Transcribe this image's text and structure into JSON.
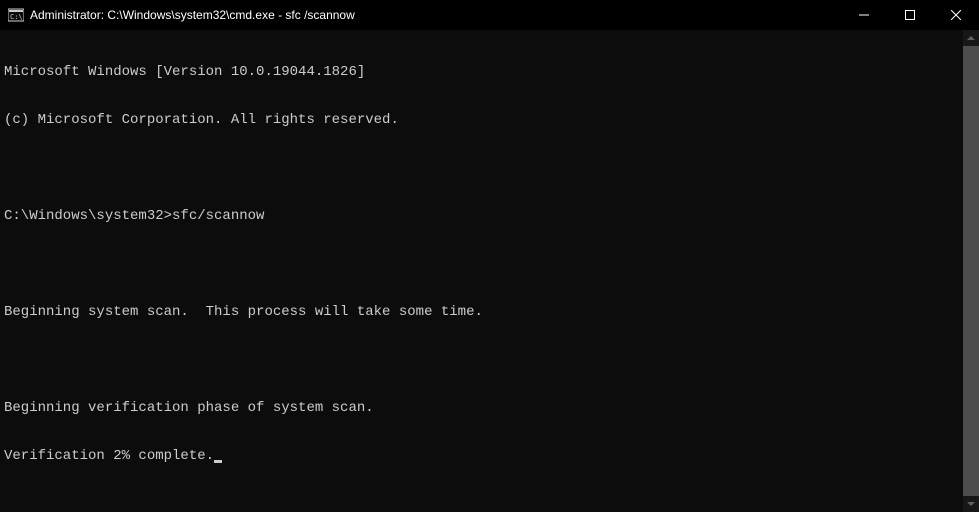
{
  "titlebar": {
    "title": "Administrator: C:\\Windows\\system32\\cmd.exe - sfc /scannow"
  },
  "terminal": {
    "lines": [
      "Microsoft Windows [Version 10.0.19044.1826]",
      "(c) Microsoft Corporation. All rights reserved.",
      "",
      "C:\\Windows\\system32>sfc/scannow",
      "",
      "Beginning system scan.  This process will take some time.",
      "",
      "Beginning verification phase of system scan.",
      "Verification 2% complete."
    ]
  }
}
